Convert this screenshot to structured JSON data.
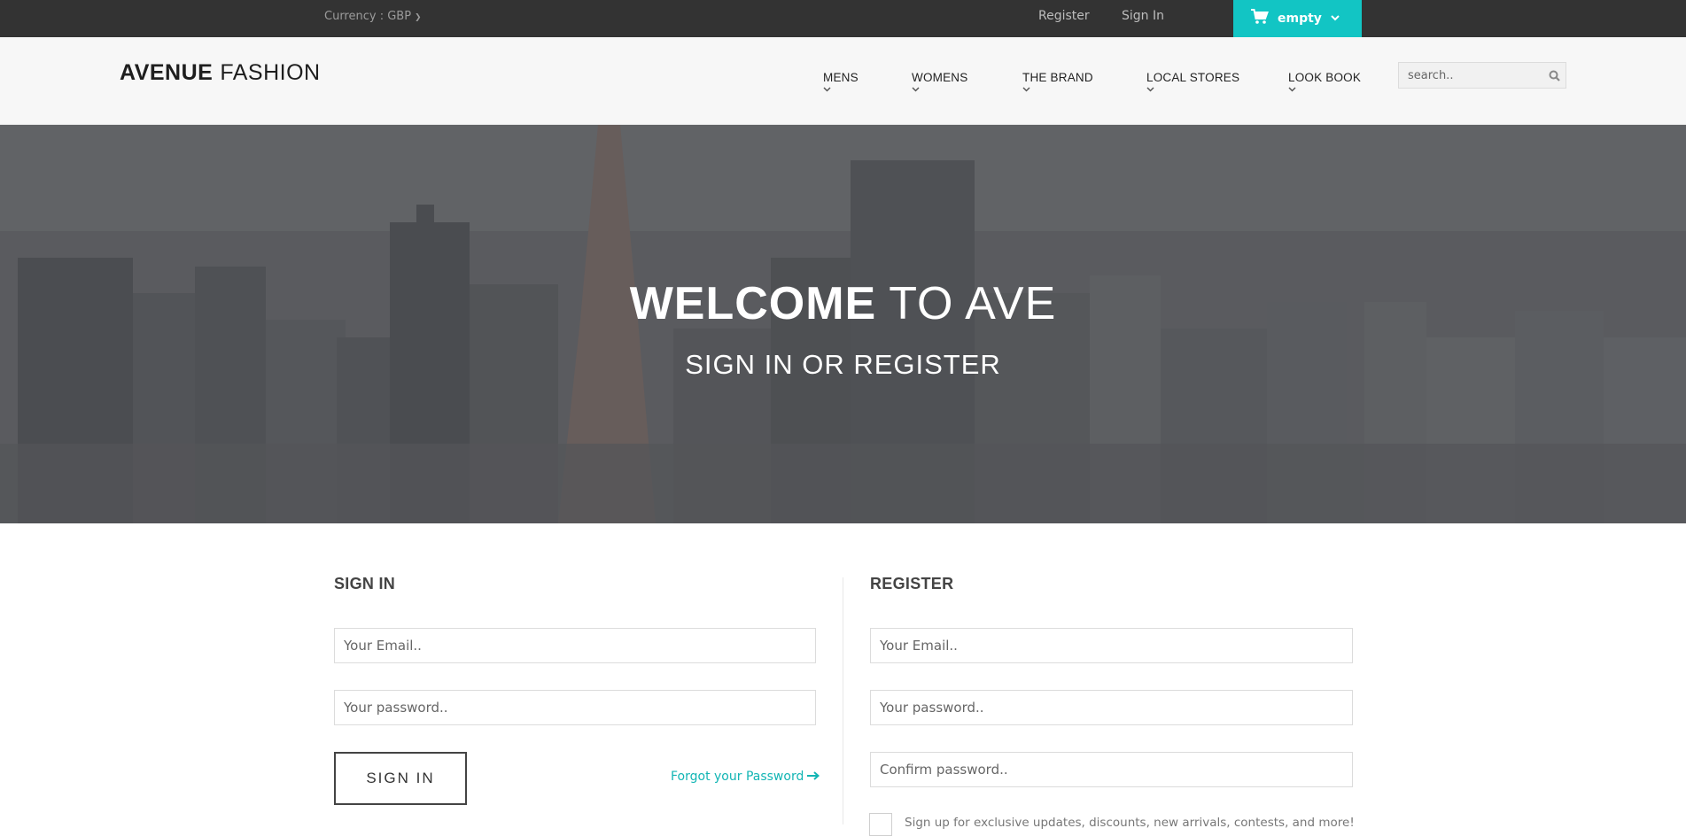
{
  "topbar": {
    "currency": "Currency : GBP",
    "register": "Register",
    "sign_in": "Sign In",
    "cart_label": "empty"
  },
  "header": {
    "logo_bold": "AVENUE",
    "logo_light": "FASHION",
    "nav": [
      {
        "label": "MENS"
      },
      {
        "label": "WOMENS"
      },
      {
        "label": "THE BRAND"
      },
      {
        "label": "LOCAL STORES"
      },
      {
        "label": "LOOK BOOK"
      }
    ],
    "search_placeholder": "search.."
  },
  "hero": {
    "title_bold": "WELCOME",
    "title_light": "TO AVE",
    "subtitle": "SIGN IN OR REGISTER"
  },
  "signin": {
    "title": "SIGN IN",
    "email_placeholder": "Your Email..",
    "password_placeholder": "Your password..",
    "button": "SIGN IN",
    "forgot": "Forgot your Password"
  },
  "register": {
    "title": "REGISTER",
    "email_placeholder": "Your Email..",
    "password_placeholder": "Your password..",
    "confirm_placeholder": "Confirm password..",
    "newsletter_label": "Sign up for exclusive updates, discounts, new arrivals, contests, and more!"
  },
  "colors": {
    "accent": "#12c5c4",
    "topbar": "#333333",
    "header": "#f7f7f7"
  }
}
